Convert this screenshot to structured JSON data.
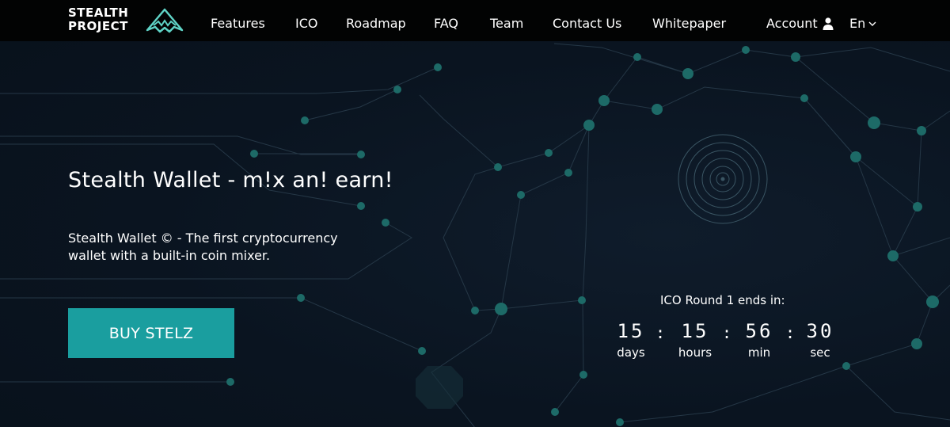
{
  "brand": {
    "line1": "STEALTH",
    "line2": "PROJECT",
    "mark_icon": "stealth-bomber-logo",
    "accent": "#5fd3c6"
  },
  "nav": {
    "items": [
      {
        "label": "Features"
      },
      {
        "label": "ICO"
      },
      {
        "label": "Roadmap"
      },
      {
        "label": "FAQ"
      },
      {
        "label": "Team"
      },
      {
        "label": "Contact Us"
      },
      {
        "label": "Whitepaper"
      }
    ],
    "account_label": "Account",
    "account_icon": "user-icon",
    "language_label": "En",
    "language_icon": "chevron-down-icon"
  },
  "hero": {
    "title": "Stealth Wallet - m!x an! earn!",
    "description": "Stealth Wallet © - The first cryptocurrency wallet with a built-in coin mixer.",
    "cta_label": "BUY STELZ",
    "cta_color": "#1a9e9f"
  },
  "countdown": {
    "label": "ICO Round 1 ends in:",
    "separator": ":",
    "units": [
      {
        "value": "15",
        "unit": "days"
      },
      {
        "value": "15",
        "unit": "hours"
      },
      {
        "value": "56",
        "unit": "min"
      },
      {
        "value": "30",
        "unit": "sec"
      }
    ]
  },
  "colors": {
    "header_bg": "#020303",
    "page_bg": "#0b1420",
    "node": "#1e6e6a",
    "line": "#2a3f4f"
  }
}
